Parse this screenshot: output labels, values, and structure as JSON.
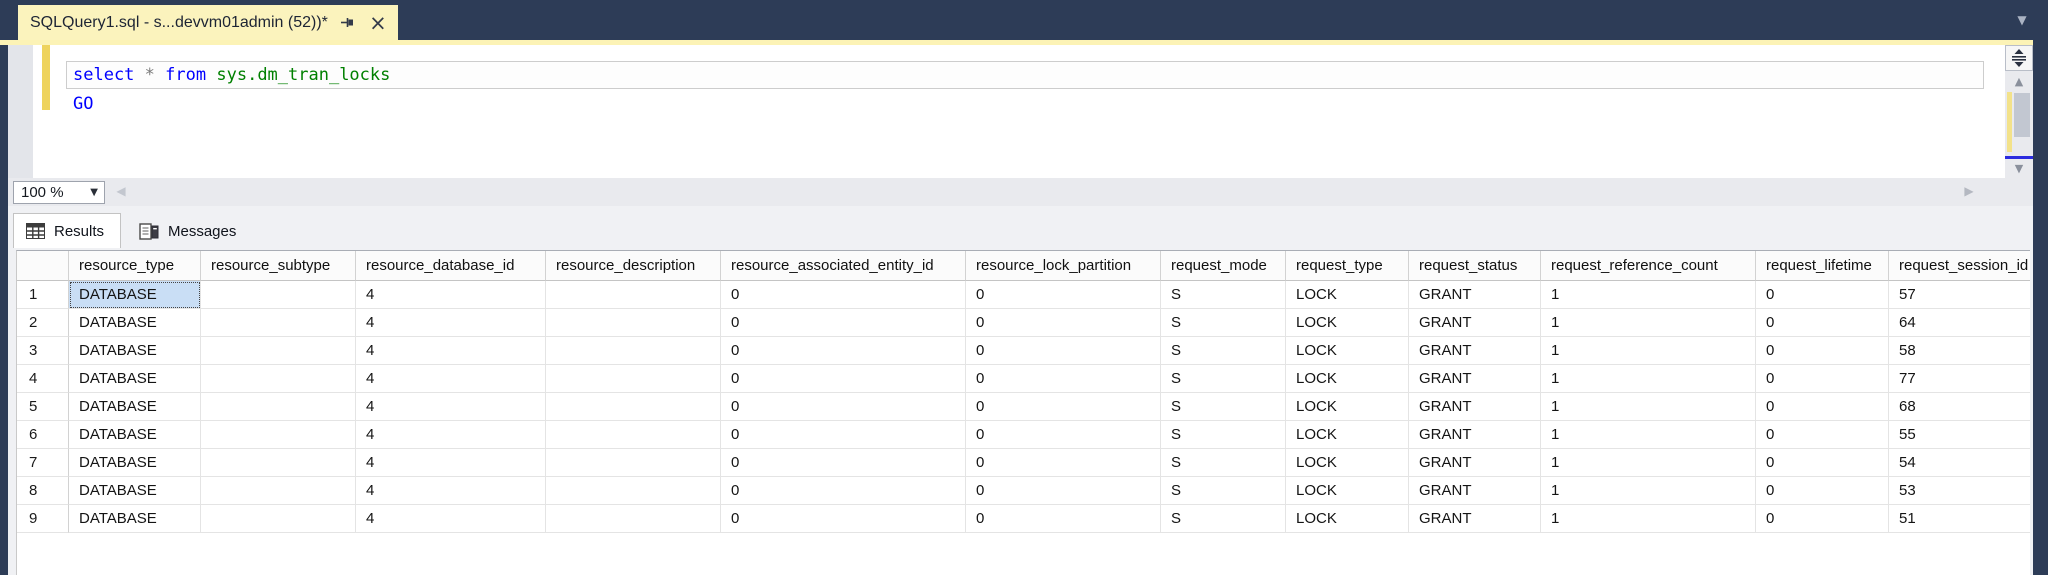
{
  "tab": {
    "title": "SQLQuery1.sql - s...devvm01admin (52))*"
  },
  "editor": {
    "lines": [
      [
        {
          "text": "select",
          "color": "#0000ff"
        },
        {
          "text": " ",
          "color": "#000000"
        },
        {
          "text": "*",
          "color": "#7a7a7a"
        },
        {
          "text": " ",
          "color": "#000000"
        },
        {
          "text": "from",
          "color": "#0000ff"
        },
        {
          "text": " ",
          "color": "#000000"
        },
        {
          "text": "sys.dm_tran_locks",
          "color": "#008000"
        }
      ],
      [
        {
          "text": "GO",
          "color": "#0000ff"
        }
      ]
    ],
    "zoom_level": "100 %"
  },
  "results": {
    "tabs": [
      {
        "label": "Results"
      },
      {
        "label": "Messages"
      }
    ],
    "active_tab": "Results",
    "grid": {
      "headers": [
        "resource_type",
        "resource_subtype",
        "resource_database_id",
        "resource_description",
        "resource_associated_entity_id",
        "resource_lock_partition",
        "request_mode",
        "request_type",
        "request_status",
        "request_reference_count",
        "request_lifetime",
        "request_session_id"
      ],
      "rows": [
        [
          "DATABASE",
          "",
          "4",
          "",
          "0",
          "0",
          "S",
          "LOCK",
          "GRANT",
          "1",
          "0",
          "57"
        ],
        [
          "DATABASE",
          "",
          "4",
          "",
          "0",
          "0",
          "S",
          "LOCK",
          "GRANT",
          "1",
          "0",
          "64"
        ],
        [
          "DATABASE",
          "",
          "4",
          "",
          "0",
          "0",
          "S",
          "LOCK",
          "GRANT",
          "1",
          "0",
          "58"
        ],
        [
          "DATABASE",
          "",
          "4",
          "",
          "0",
          "0",
          "S",
          "LOCK",
          "GRANT",
          "1",
          "0",
          "77"
        ],
        [
          "DATABASE",
          "",
          "4",
          "",
          "0",
          "0",
          "S",
          "LOCK",
          "GRANT",
          "1",
          "0",
          "68"
        ],
        [
          "DATABASE",
          "",
          "4",
          "",
          "0",
          "0",
          "S",
          "LOCK",
          "GRANT",
          "1",
          "0",
          "55"
        ],
        [
          "DATABASE",
          "",
          "4",
          "",
          "0",
          "0",
          "S",
          "LOCK",
          "GRANT",
          "1",
          "0",
          "54"
        ],
        [
          "DATABASE",
          "",
          "4",
          "",
          "0",
          "0",
          "S",
          "LOCK",
          "GRANT",
          "1",
          "0",
          "53"
        ],
        [
          "DATABASE",
          "",
          "4",
          "",
          "0",
          "0",
          "S",
          "LOCK",
          "GRANT",
          "1",
          "0",
          "51"
        ]
      ],
      "selection": {
        "row": 1,
        "column": "resource_type"
      }
    }
  },
  "icons": {
    "dropdown": "▼",
    "up": "▲",
    "down": "▼",
    "left": "◀",
    "right": "▶",
    "close": "×"
  },
  "colors": {
    "frame_navy": "#2d3c57",
    "active_tab_yellow": "#fbf3bd",
    "change_bar_yellow": "#eed35d",
    "selected_cell_blue": "#c9def5",
    "keyword_blue": "#0000ff",
    "object_green": "#008000",
    "scroll_caret_blue": "#2b2bdf"
  }
}
